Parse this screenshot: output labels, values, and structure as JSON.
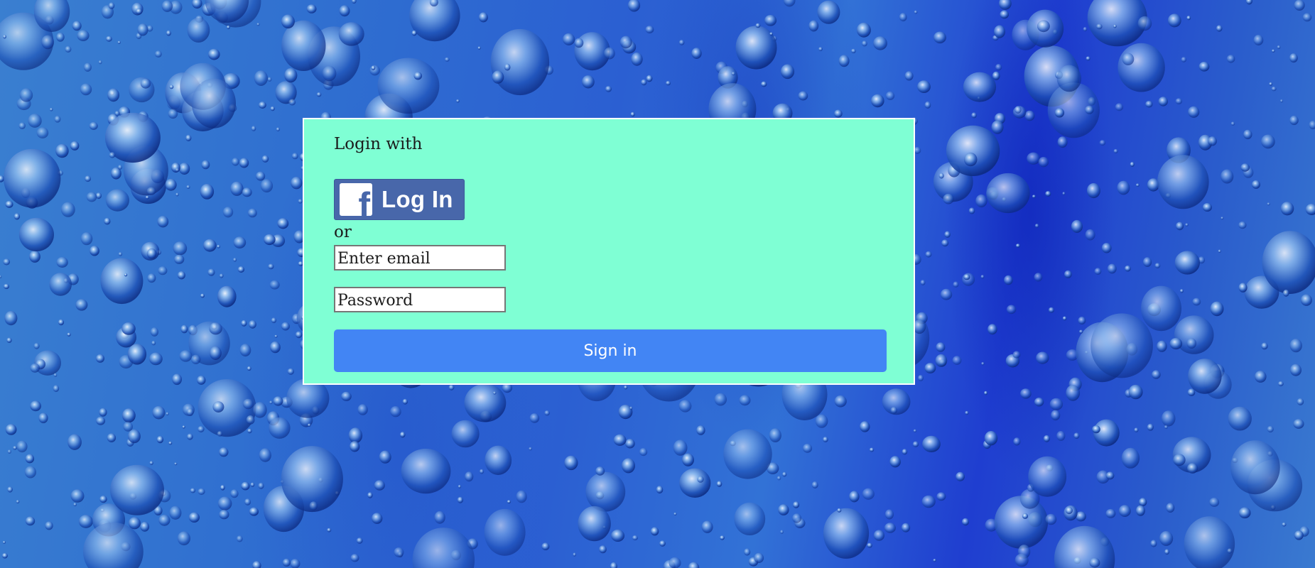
{
  "background": {
    "description_icon": "water-droplets-background"
  },
  "login_panel": {
    "heading": "Login with",
    "facebook_button": {
      "icon": "facebook-f-icon",
      "icon_glyph": "f",
      "label": "Log In",
      "color": "#4867aa"
    },
    "separator": "or",
    "email_field": {
      "value": "",
      "placeholder": "Enter email"
    },
    "password_field": {
      "value": "",
      "placeholder": "Password"
    },
    "signin_button": {
      "label": "Sign in",
      "color": "#4285f4"
    },
    "background_color": "#7fffd4"
  }
}
